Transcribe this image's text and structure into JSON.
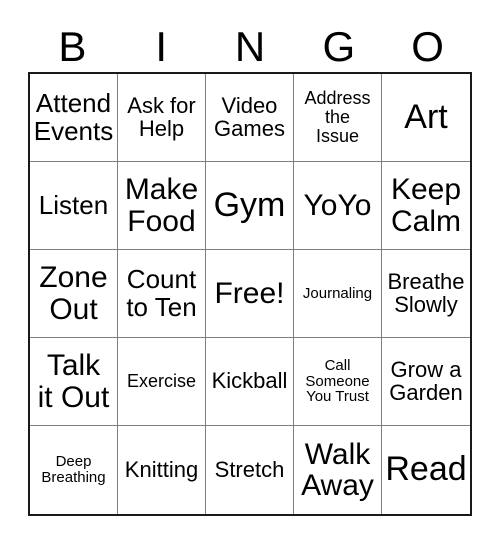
{
  "card": {
    "header_letters": [
      "B",
      "I",
      "N",
      "G",
      "O"
    ],
    "grid": {
      "columns": 5,
      "rows": 5,
      "border_color": "#1a1a1a",
      "inner_line_color": "#7f7f7f",
      "background": "#ffffff",
      "text_color": "#000000"
    },
    "cells": [
      {
        "text": "Attend\nEvents",
        "size": "lg",
        "free": false
      },
      {
        "text": "Ask for\nHelp",
        "size": "md",
        "free": false
      },
      {
        "text": "Video\nGames",
        "size": "md",
        "free": false
      },
      {
        "text": "Address\nthe\nIssue",
        "size": "sm",
        "free": false
      },
      {
        "text": "Art",
        "size": "xxl",
        "free": false
      },
      {
        "text": "Listen",
        "size": "lg",
        "free": false
      },
      {
        "text": "Make\nFood",
        "size": "xl",
        "free": false
      },
      {
        "text": "Gym",
        "size": "xxl",
        "free": false
      },
      {
        "text": "YoYo",
        "size": "xl",
        "free": false
      },
      {
        "text": "Keep\nCalm",
        "size": "xl",
        "free": false
      },
      {
        "text": "Zone\nOut",
        "size": "xl",
        "free": false
      },
      {
        "text": "Count\nto Ten",
        "size": "lg",
        "free": false
      },
      {
        "text": "Free!",
        "size": "xl",
        "free": true
      },
      {
        "text": "Journaling",
        "size": "xs",
        "free": false
      },
      {
        "text": "Breathe\nSlowly",
        "size": "md",
        "free": false
      },
      {
        "text": "Talk\nit Out",
        "size": "xl",
        "free": false
      },
      {
        "text": "Exercise",
        "size": "sm",
        "free": false
      },
      {
        "text": "Kickball",
        "size": "md",
        "free": false
      },
      {
        "text": "Call\nSomeone\nYou Trust",
        "size": "xs",
        "free": false
      },
      {
        "text": "Grow a\nGarden",
        "size": "md",
        "free": false
      },
      {
        "text": "Deep\nBreathing",
        "size": "xs",
        "free": false
      },
      {
        "text": "Knitting",
        "size": "md",
        "free": false
      },
      {
        "text": "Stretch",
        "size": "md",
        "free": false
      },
      {
        "text": "Walk\nAway",
        "size": "xl",
        "free": false
      },
      {
        "text": "Read",
        "size": "xxl",
        "free": false
      }
    ]
  }
}
